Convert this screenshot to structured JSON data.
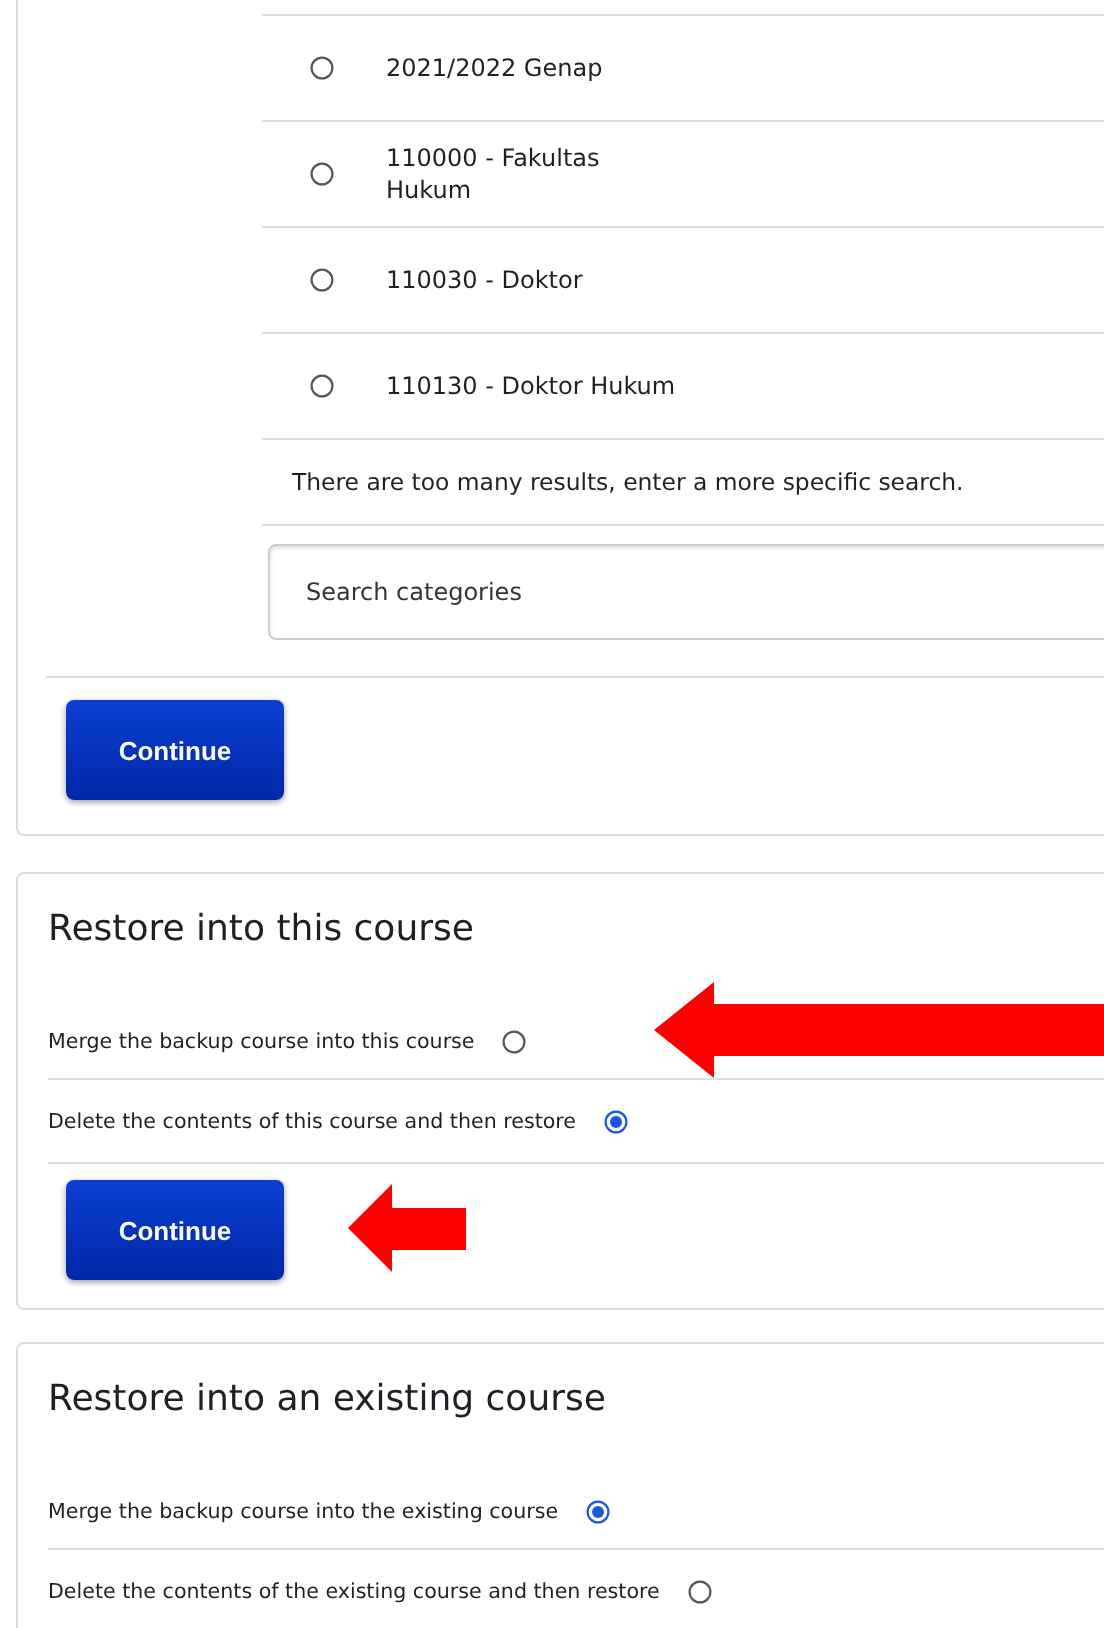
{
  "category_list": {
    "items": [
      {
        "label": "2021/2022 Genap",
        "selected": false
      },
      {
        "label": "110000 - Fakultas\nHukum",
        "selected": false
      },
      {
        "label": "110030 - Doktor",
        "selected": false
      },
      {
        "label": "110130 - Doktor Hukum",
        "selected": false
      }
    ],
    "message": "There are too many results, enter a more specific search.",
    "search": {
      "placeholder": "Search categories"
    },
    "continue_button": "Continue"
  },
  "restore_sections": [
    {
      "title": "Restore into this course",
      "options": [
        {
          "label": "Merge the backup course into this course",
          "selected": false,
          "arrow": true
        },
        {
          "label": "Delete the contents of this course and then restore",
          "selected": true,
          "arrow": false
        }
      ],
      "continue_button": {
        "label": "Continue",
        "arrow": true
      }
    },
    {
      "title": "Restore into an existing course",
      "options": [
        {
          "label": "Merge the backup course into the existing course",
          "selected": true,
          "arrow": false
        },
        {
          "label": "Delete the contents of the existing course and then restore",
          "selected": false,
          "arrow": false
        }
      ]
    }
  ]
}
